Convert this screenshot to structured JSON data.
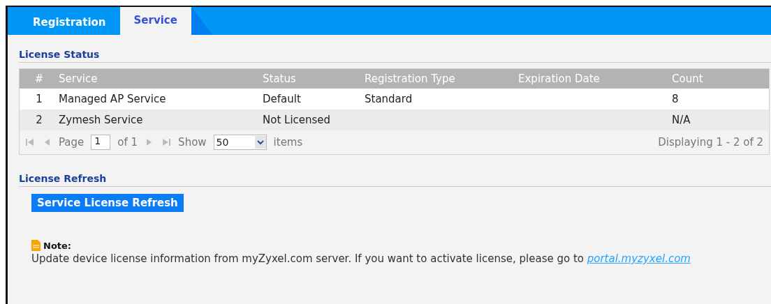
{
  "tabs": [
    {
      "label": "Registration",
      "selected": false
    },
    {
      "label": "Service",
      "selected": true
    }
  ],
  "license_status": {
    "title": "License Status",
    "table": {
      "columns": [
        "#",
        "Service",
        "Status",
        "Registration Type",
        "Expiration Date",
        "Count"
      ],
      "rows": [
        [
          "1",
          "Managed AP Service",
          "Default",
          "Standard",
          "",
          "8"
        ],
        [
          "2",
          "Zymesh Service",
          "Not Licensed",
          "",
          "",
          "N/A"
        ]
      ]
    },
    "pager": {
      "page_label": "Page",
      "page": "1",
      "of_label": "of 1",
      "show_label": "Show",
      "per_page": "50",
      "items_label": "items",
      "summary": "Displaying 1 - 2 of 2"
    }
  },
  "license_refresh": {
    "title": "License Refresh",
    "button": "Service License Refresh",
    "note_title": "Note:",
    "note_text": "Update device license information from myZyxel.com server. If you want to activate license, please go to",
    "note_link": "portal.myzyxel.com"
  }
}
